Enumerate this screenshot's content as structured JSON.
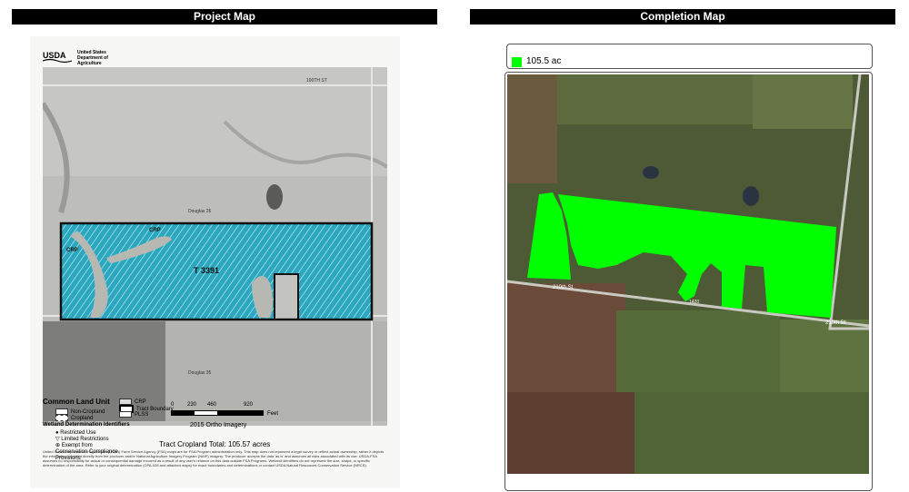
{
  "headers": {
    "left": "Project Map",
    "right": "Completion Map"
  },
  "project_map": {
    "agency_line1": "USDA",
    "agency_text": "United States Department of Agriculture",
    "road_label": "100TH ST",
    "tract_label": "T 3391",
    "crp_labels": [
      "CRP",
      "CRP"
    ],
    "township_top": "Douglas 26",
    "township_bottom": "Douglas 35",
    "legend": {
      "title": "Common Land Unit",
      "non_cropland": "Non-Cropland",
      "cropland": "Cropland",
      "wetland_title": "Wetland Determination Identifiers",
      "restricted_use": "Restricted Use",
      "limited_restrictions": "Limited Restrictions",
      "exempt": "Exempt from Conservation Compliance Provisions",
      "crp": "CRP",
      "tract_boundary": "Tract Boundary",
      "plss": "PLSS"
    },
    "scale": {
      "ticks": [
        "0",
        "230",
        "460",
        "920"
      ],
      "unit": "Feet"
    },
    "imagery": "2015 Ortho Imagery",
    "total": "Tract Cropland Total:  105.57 acres",
    "disclaimer": "United States Department of Agriculture (USDA) Farm Service Agency (FSA) maps are for FSA Program administration only. This map does not represent a legal survey or reflect actual ownership; rather it depicts the information provided directly from the producer and/or National Agriculture Imagery Program (NAIP) imagery. The producer accepts the data 'as is' and assumes all risks associated with its use. USDA-FSA assumes no responsibility for actual or consequential damage incurred as a result of any user's reliance on this data outside FSA Programs. Wetland identifiers do not represent the size, shape, or specific determination of the area. Refer to your original determination (CPA-026 and attached maps) for exact boundaries and determinations or contact USDA Natural Resources Conservation Service (NRCS)."
  },
  "completion_map": {
    "legend_label": "105.5 ac",
    "colors": {
      "completion": "#00ff00"
    },
    "road_labels": [
      "210th St",
      "210th St",
      "1420"
    ]
  }
}
